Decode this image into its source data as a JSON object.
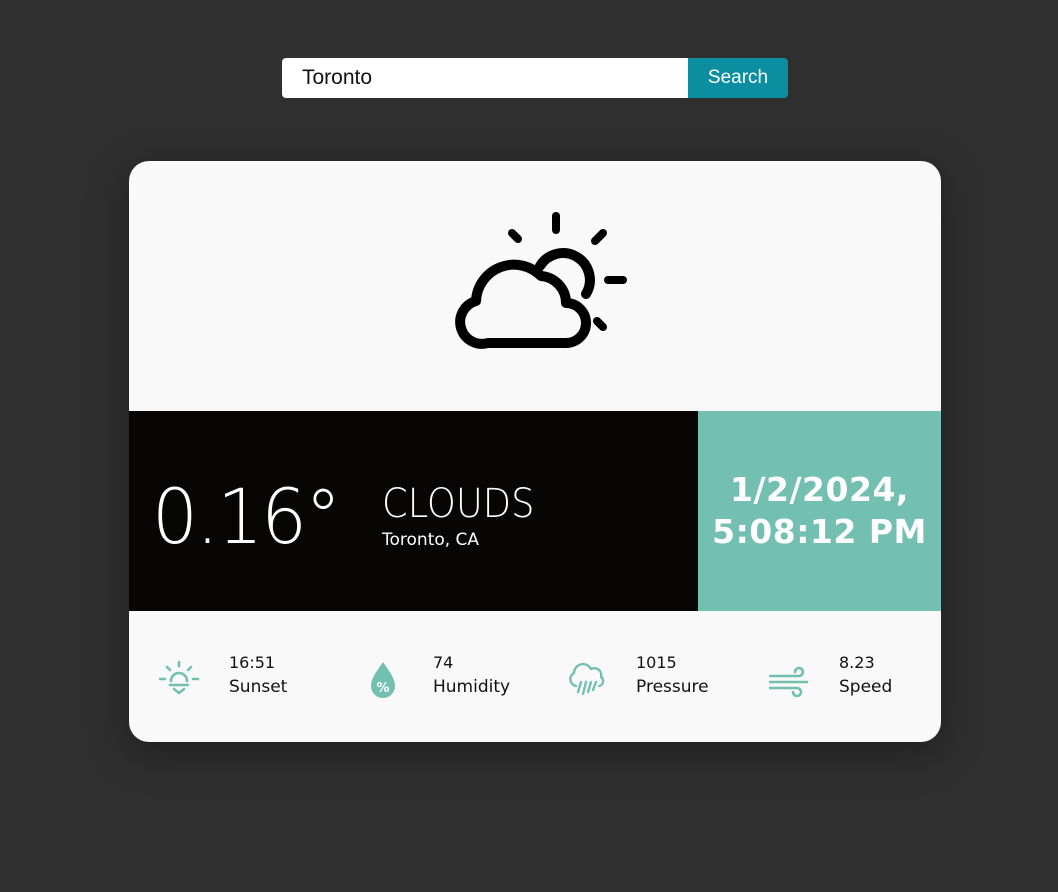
{
  "search": {
    "value": "Toronto",
    "button_label": "Search"
  },
  "weather": {
    "icon": "partly-cloudy-icon",
    "temperature": "0.16°",
    "condition": "CLOUDS",
    "location": "Toronto, CA",
    "date": "1/2/2024,",
    "time": "5:08:12 PM"
  },
  "stats": [
    {
      "icon": "sunset-icon",
      "value": "16:51",
      "label": "Sunset"
    },
    {
      "icon": "humidity-icon",
      "value": "74",
      "label": "Humidity"
    },
    {
      "icon": "pressure-rain-icon",
      "value": "1015",
      "label": "Pressure"
    },
    {
      "icon": "wind-icon",
      "value": "8.23",
      "label": "Speed"
    }
  ],
  "colors": {
    "background": "#2f2f2f",
    "card": "#f9f9f9",
    "band_dark": "#070604",
    "accent_teal": "#73c0b2",
    "search_button": "#0b8fa0"
  }
}
